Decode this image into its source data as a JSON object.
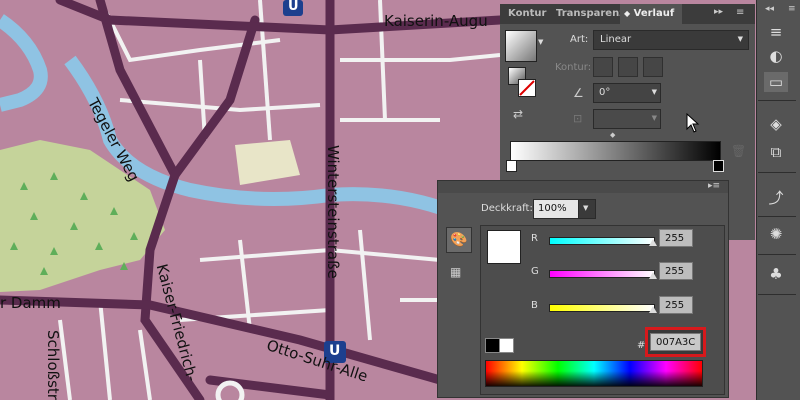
{
  "map": {
    "labels": {
      "kaiserin": "Kaiserin-Augu",
      "tegeler": "Tegeler Weg",
      "winterstein": "Wintersteinstraße",
      "kaiser_friedrich": "Kaiser-Friedrich-",
      "otto_suhr": "Otto-Suhr-Alle",
      "damm": "r Damm",
      "schloss": "Schloßstr",
      "ubahn": "U"
    }
  },
  "gradient_panel": {
    "tabs": [
      "Kontur",
      "Transparenz",
      "Verlauf"
    ],
    "active_tab_icon": "double-arrow-icon",
    "art_label": "Art:",
    "art_value": "Linear",
    "kontur_label": "Kontur:",
    "angle_value": "0°"
  },
  "color_panel": {
    "opacity_label": "Deckkraft:",
    "opacity_value": "100%",
    "channels": [
      {
        "label": "R",
        "value": "255",
        "level": 1.0
      },
      {
        "label": "G",
        "value": "255",
        "level": 1.0
      },
      {
        "label": "B",
        "value": "255",
        "level": 1.0
      }
    ],
    "hash_label": "#",
    "hex_value": "007A3C"
  },
  "colors": {
    "panel_bg": "#535353",
    "highlight_red": "#d7191c",
    "map_road": "#5a2b4e",
    "map_block": "#b9869f",
    "river": "#8fc3e3",
    "park": "#c8d49a"
  }
}
